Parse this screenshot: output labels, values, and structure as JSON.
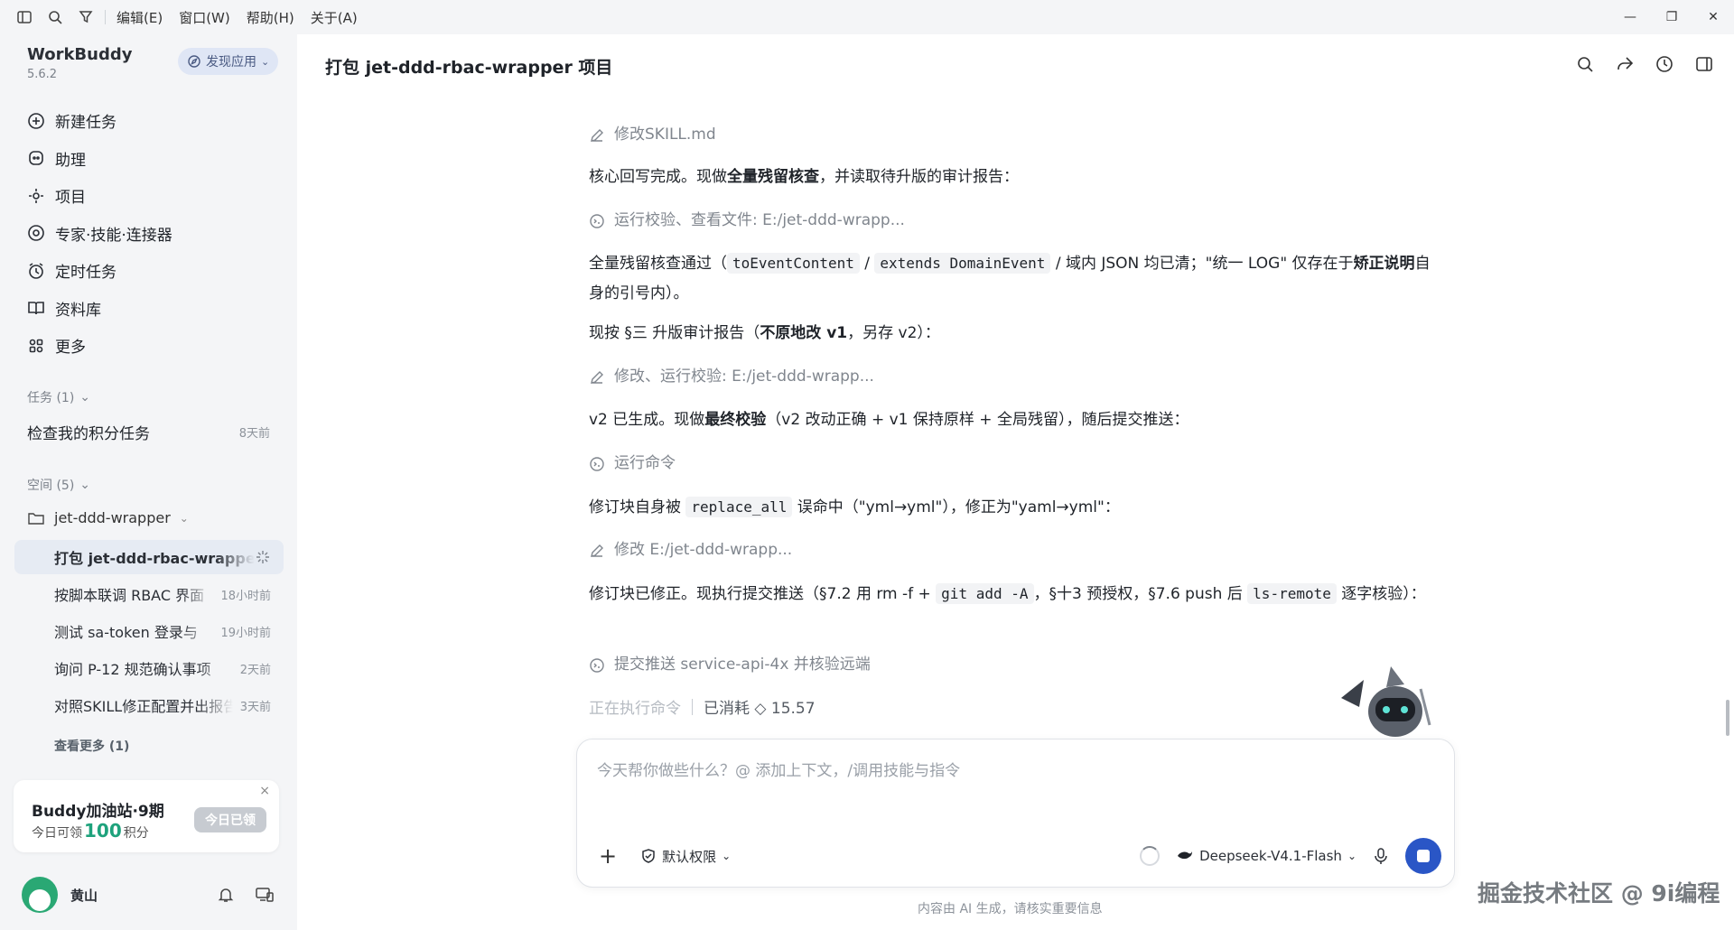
{
  "menu": [
    "编辑(E)",
    "窗口(W)",
    "帮助(H)",
    "关于(A)"
  ],
  "window": {
    "min": "—",
    "restore": "❐",
    "close": "✕"
  },
  "sidebar": {
    "brand": "WorkBuddy",
    "version": "5.6.2",
    "discover": "发现应用",
    "nav": [
      {
        "label": "新建任务"
      },
      {
        "label": "助理"
      },
      {
        "label": "项目"
      },
      {
        "label": "专家·技能·连接器"
      },
      {
        "label": "定时任务"
      },
      {
        "label": "资料库"
      },
      {
        "label": "更多"
      }
    ],
    "tasks_header": "任务 (1)",
    "tasks": [
      {
        "title": "检查我的积分任务",
        "time": "8天前"
      }
    ],
    "space_header": "空间 (5)",
    "space_folder": "jet-ddd-wrapper",
    "projects": [
      {
        "title": "打包 jet-ddd-rbac-wrapper 项目",
        "time": ""
      },
      {
        "title": "按脚本联调 RBAC 界面",
        "time": "18小时前"
      },
      {
        "title": "测试 sa-token 登录与",
        "time": "19小时前"
      },
      {
        "title": "询问 P-12 规范确认事项",
        "time": "2天前"
      },
      {
        "title": "对照SKILL修正配置并出报告",
        "time": "3天前"
      }
    ],
    "see_more": "查看更多 (1)",
    "promo": {
      "title": "Buddy加油站·9期",
      "sub_prefix": "今日可领",
      "sub_num": "100",
      "sub_suffix": "积分",
      "button": "今日已领",
      "close": "×"
    },
    "user": {
      "name": "黄山"
    }
  },
  "main": {
    "title": "打包 jet-ddd-rbac-wrapper 项目",
    "msgs": {
      "m1_tool": "修改SKILL.md",
      "m2_a": "核心回写完成。现做",
      "m2_b": "全量残留核查",
      "m2_c": "，并读取待升版的审计报告：",
      "m3_tool": "运行校验、查看文件: E:/jet-ddd-wrapp...",
      "m4_a": "全量残留核查通过（",
      "m4_code1": "toEventContent",
      "m4_s1": " / ",
      "m4_code2": "extends DomainEvent",
      "m4_b": " / 域内 JSON 均已清；\"统一 LOG\" 仅存在于",
      "m4_bold": "矫正说明",
      "m4_c": "自身的引号内）。",
      "m5_a": "现按 §三 升版审计报告（",
      "m5_b": "不原地改 v1",
      "m5_c": "，另存 v2）：",
      "m6_tool": "修改、运行校验: E:/jet-ddd-wrapp...",
      "m7_a": "v2 已生成。现做",
      "m7_b": "最终校验",
      "m7_c": "（v2 改动正确 + v1 保持原样 + 全局残留），随后提交推送：",
      "m8_tool": "运行命令",
      "m9_a": "修订块自身被 ",
      "m9_code": "replace_all",
      "m9_b": " 误命中（\"yml→yml\"），修正为\"yaml→yml\"：",
      "m10_tool": "修改 E:/jet-ddd-wrapp...",
      "m11_a": "修订块已修正。现执行提交推送（§7.2 用 rm -f + ",
      "m11_code1": "git add -A",
      "m11_b": "，§十3 预授权，§7.6 push 后 ",
      "m11_code2": "ls-remote",
      "m11_c": " 逐字核验）：",
      "m12_tool": "提交推送 service-api-4x 并核验远端"
    },
    "status": {
      "running": "正在执行命令",
      "cost": "已消耗 ◇ 15.57"
    }
  },
  "input": {
    "placeholder": "今天帮你做些什么？@ 添加上下文，/调用技能与指令",
    "permission": "默认权限",
    "model": "Deepseek-V4.1-Flash",
    "add": "+"
  },
  "disclaimer": "内容由 AI 生成，请核实重要信息",
  "watermark": "掘金技术社区 @ 9i编程"
}
